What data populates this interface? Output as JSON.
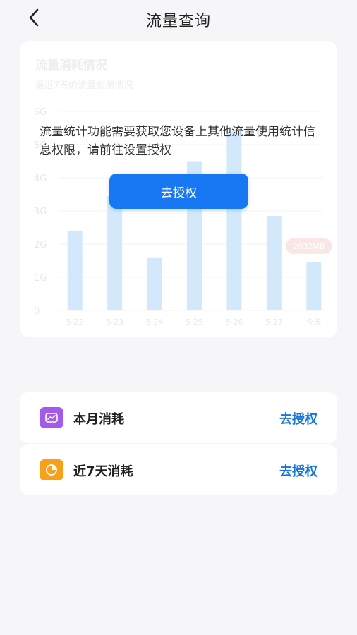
{
  "header": {
    "title": "流量查询"
  },
  "usage_card": {
    "title": "流量消耗情况",
    "subtitle": "最近7天的流量使用情况",
    "permission_message": "流量统计功能需要获取您设备上其他流量使用统计信息权限，请前往设置授权",
    "authorize_button_label": "去授权",
    "highlight_badge": "2032MB"
  },
  "chart_data": {
    "type": "bar",
    "categories": [
      "5-22",
      "5-23",
      "5-24",
      "5-25",
      "5-26",
      "5-27",
      "今天"
    ],
    "values": [
      2.4,
      3.45,
      1.6,
      4.5,
      5.4,
      2.85,
      1.45
    ],
    "unit": "G",
    "ylim": [
      0,
      6
    ],
    "y_ticks": [
      "0",
      "1G",
      "2G",
      "3G",
      "4G",
      "5G",
      "6G"
    ],
    "grid": true,
    "bar_color": "#9fd0f7",
    "badge_color": "#f8c9c9"
  },
  "stats": [
    {
      "label": "本月消耗",
      "action": "去授权",
      "icon": "trend-chart-icon",
      "icon_color": "#a45ae8"
    },
    {
      "label": "近7天消耗",
      "action": "去授权",
      "icon": "pie-chart-icon",
      "icon_color": "#f7a11a"
    }
  ],
  "colors": {
    "accent": "#1877f2",
    "link": "#1877d6",
    "background": "#f6f6f8"
  }
}
